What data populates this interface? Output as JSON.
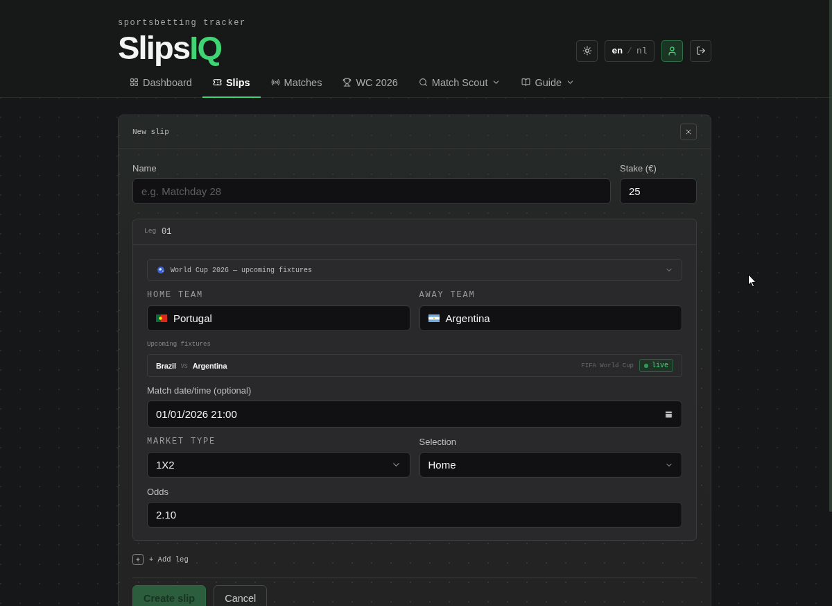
{
  "header": {
    "tagline": "sportsbetting tracker",
    "logo": {
      "name": "Slips",
      "accent": "IQ"
    },
    "actions": [
      {
        "kind": "theme",
        "selected": false
      },
      {
        "kind": "language",
        "separator": "/",
        "options": [
          {
            "label": "en",
            "selected": true
          },
          {
            "label": "nl",
            "selected": false
          }
        ]
      },
      {
        "kind": "profile",
        "selected": true
      },
      {
        "kind": "logout",
        "selected": false
      }
    ]
  },
  "nav": [
    {
      "label": "Dashboard",
      "selected": false,
      "has_menu": false
    },
    {
      "label": "Slips",
      "selected": true,
      "has_menu": false
    },
    {
      "label": "Matches",
      "selected": false,
      "has_menu": false
    },
    {
      "label": "WC 2026",
      "selected": false,
      "has_menu": false
    },
    {
      "label": "Match Scout",
      "selected": false,
      "has_menu": true
    },
    {
      "label": "Guide",
      "selected": false,
      "has_menu": true
    }
  ],
  "slip_form": {
    "title": "New slip",
    "name": {
      "label": "Name",
      "placeholder": "e.g. Matchday 28"
    },
    "stake": {
      "label": "Stake (€)",
      "value": "25"
    },
    "legs": [
      {
        "label": "Leg",
        "number": "01",
        "competition": "World Cup 2026 — upcoming fixtures",
        "home_team": {
          "label": "HOME TEAM",
          "value": "Portugal"
        },
        "away_team": {
          "label": "AWAY TEAM",
          "value": "Argentina"
        },
        "fixtures": {
          "title": "Upcoming fixtures",
          "items": [
            {
              "home": "Brazil",
              "vs": "vs",
              "away": "Argentina",
              "competition": "FIFA World Cup",
              "status": "live"
            }
          ]
        },
        "match_date": {
          "label": "Match date/time (optional)",
          "value": "01/01/2026 21:00"
        },
        "market_type": {
          "label": "MARKET TYPE",
          "value": "1X2"
        },
        "selection": {
          "label": "Selection",
          "value": "Home"
        },
        "odds": {
          "label": "Odds",
          "value": "2.10"
        }
      }
    ],
    "add_leg": "+ Add leg",
    "buttons": [
      {
        "label": "Create slip",
        "kind": "primary"
      },
      {
        "label": "Cancel",
        "kind": "secondary"
      }
    ]
  }
}
